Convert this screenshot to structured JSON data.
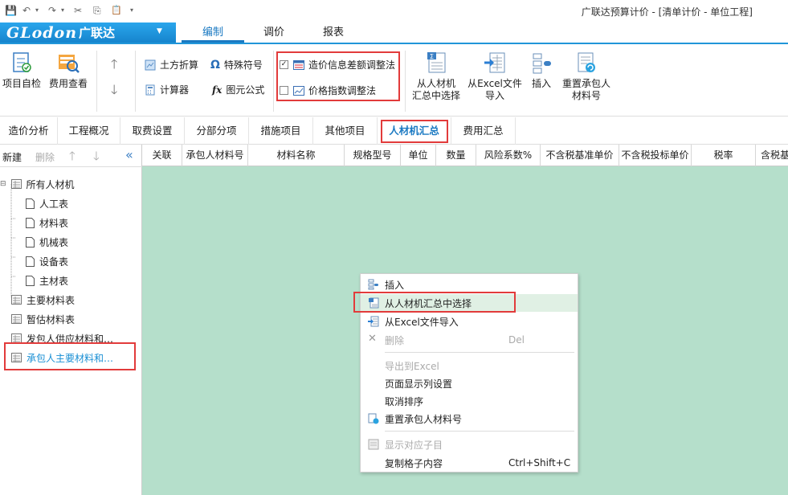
{
  "app": {
    "title": "广联达预算计价 - [清单计价 - 单位工程]"
  },
  "quick_access": {
    "save": "💾",
    "undo": "↶",
    "redo": "↷",
    "cut": "✂",
    "copy": "⎘",
    "paste": "📋",
    "more": "▾"
  },
  "brand": {
    "logo_en": "GLodon",
    "logo_cn": "广联达",
    "arrow": "▼"
  },
  "menu_tabs": [
    {
      "label": "编制"
    },
    {
      "label": "调价"
    },
    {
      "label": "报表"
    }
  ],
  "ribbon": {
    "self_check": "项目自检",
    "cost_view": "费用查看",
    "earthwork": "土方折算",
    "special_symbol": "特殊符号",
    "calculator": "计算器",
    "formula": "图元公式",
    "check_diff": "造价信息差额调整法",
    "check_index": "价格指数调整法",
    "from_summary": [
      "从人材机",
      "汇总中选择"
    ],
    "from_excel": [
      "从Excel文件",
      "导入"
    ],
    "insert": "插入",
    "reset": [
      "重置承包人",
      "材料号"
    ]
  },
  "nav_tabs": [
    {
      "label": "造价分析"
    },
    {
      "label": "工程概况"
    },
    {
      "label": "取费设置"
    },
    {
      "label": "分部分项"
    },
    {
      "label": "措施项目"
    },
    {
      "label": "其他项目"
    },
    {
      "label": "人材机汇总"
    },
    {
      "label": "费用汇总"
    }
  ],
  "sidebar": {
    "new": "新建",
    "delete": "删除",
    "tree": [
      {
        "label": "所有人材机"
      },
      {
        "label": "人工表"
      },
      {
        "label": "材料表"
      },
      {
        "label": "机械表"
      },
      {
        "label": "设备表"
      },
      {
        "label": "主材表"
      },
      {
        "label": "主要材料表"
      },
      {
        "label": "暂估材料表"
      },
      {
        "label": "发包人供应材料和…"
      },
      {
        "label": "承包人主要材料和…"
      }
    ]
  },
  "grid": {
    "columns": [
      "关联",
      "承包人材料号",
      "材料名称",
      "规格型号",
      "单位",
      "数量",
      "风险系数%",
      "不含税基准单价",
      "不含税投标单价",
      "税率",
      "含税基"
    ]
  },
  "context_menu": {
    "items": [
      {
        "label": "插入"
      },
      {
        "label": "从人材机汇总中选择"
      },
      {
        "label": "从Excel文件导入"
      },
      {
        "label": "删除",
        "shortcut": "Del"
      },
      {
        "label": "导出到Excel"
      },
      {
        "label": "页面显示列设置"
      },
      {
        "label": "取消排序"
      },
      {
        "label": "重置承包人材料号"
      },
      {
        "label": "显示对应子目"
      },
      {
        "label": "复制格子内容",
        "shortcut": "Ctrl+Shift+C"
      }
    ]
  },
  "colors": {
    "accent": "#1a79c2",
    "highlight_box": "#e23b3b",
    "grid_bg": "#b5dfcb"
  }
}
